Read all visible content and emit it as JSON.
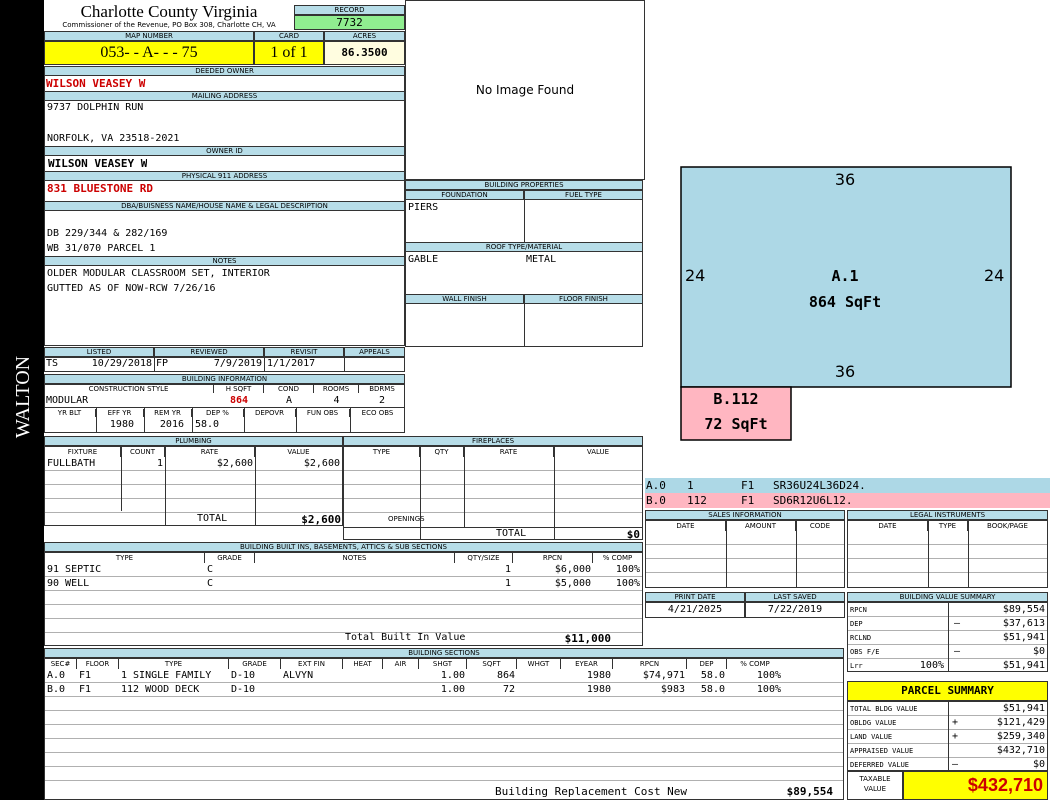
{
  "header": {
    "county": "Charlotte County Virginia",
    "commissioner": "Commissioner of the Revenue, PO Box 308, Charlotte CH, VA",
    "record_label": "RECORD",
    "record": "7732",
    "map_label": "MAP NUMBER",
    "map_number": "053- - A- - - 75",
    "card_label": "CARD",
    "card": "1 of 1",
    "acres_label": "ACRES",
    "acres": "86.3500",
    "side_label": "WALTON"
  },
  "owner": {
    "deeded_label": "DEEDED OWNER",
    "deeded": "WILSON VEASEY W",
    "mailing_label": "MAILING ADDRESS",
    "mail1": "9737 DOLPHIN RUN",
    "mail2": "NORFOLK, VA 23518-2021",
    "id_label": "OWNER ID",
    "id": "WILSON VEASEY W",
    "addr_label": "PHYSICAL 911 ADDRESS",
    "addr": "831 BLUESTONE RD",
    "legal_label": "DBA/BUISNESS NAME/HOUSE NAME & LEGAL DESCRIPTION",
    "legal1": "DB 229/344 & 282/169",
    "legal2": "WB 31/070 PARCEL 1",
    "notes_label": "NOTES",
    "notes1": "OLDER MODULAR CLASSROOM SET, INTERIOR",
    "notes2": "GUTTED AS OF NOW-RCW 7/26/16"
  },
  "image": {
    "text": "No Image Found"
  },
  "props": {
    "title": "BUILDING PROPERTIES",
    "foundation_label": "FOUNDATION",
    "fuel_label": "FUEL TYPE",
    "foundation": "PIERS",
    "roof_label": "ROOF TYPE/MATERIAL",
    "roof_type": "GABLE",
    "roof_mat": "METAL",
    "wall_label": "WALL FINISH",
    "floor_label": "FLOOR FINISH"
  },
  "dates": {
    "listed_label": "LISTED",
    "listed_code": "TS",
    "listed": "10/29/2018",
    "reviewed_label": "REVIEWED",
    "reviewed_code": "FP",
    "reviewed": "7/9/2019",
    "revisit_label": "REVISIT",
    "revisit": "1/1/2017",
    "appeals_label": "APPEALS"
  },
  "bldg": {
    "title": "BUILDING INFORMATION",
    "cs_label": "CONSTRUCTION STYLE",
    "hsqft_label": "H SQFT",
    "cond_label": "COND",
    "rooms_label": "ROOMS",
    "bdrms_label": "BDRMS",
    "style": "MODULAR",
    "hsqft": "864",
    "cond": "A",
    "rooms": "4",
    "bdrms": "2",
    "yrblt_label": "YR BLT",
    "effyr_label": "EFF YR",
    "remyr_label": "REM YR",
    "dep_label": "DEP %",
    "depovr_label": "DEPOVR",
    "funobs_label": "FUN OBS",
    "ecoobs_label": "ECO OBS",
    "yrblt": "1980",
    "remyr": "2016",
    "dep": "58.0"
  },
  "plumbing": {
    "title": "PLUMBING",
    "cols": [
      "FIXTURE",
      "COUNT",
      "RATE",
      "VALUE"
    ],
    "rows": [
      [
        "FULLBATH",
        "1",
        "$2,600",
        "$2,600"
      ]
    ],
    "total_label": "TOTAL",
    "total": "$2,600"
  },
  "fireplaces": {
    "title": "FIREPLACES",
    "cols": [
      "TYPE",
      "QTY",
      "RATE",
      "VALUE"
    ],
    "openings_label": "OPENINGS",
    "total_label": "TOTAL",
    "total": "$0"
  },
  "builtins": {
    "title": "BUILDING BUILT INS, BASEMENTS, ATTICS & SUB SECTIONS",
    "cols": [
      "TYPE",
      "GRADE",
      "NOTES",
      "QTY/SIZE",
      "RPCN",
      "% COMP"
    ],
    "rows": [
      [
        "91 SEPTIC",
        "C",
        "",
        "1",
        "$6,000",
        "100%"
      ],
      [
        "90 WELL",
        "C",
        "",
        "1",
        "$5,000",
        "100%"
      ]
    ],
    "total_label": "Total Built In Value",
    "total": "$11,000"
  },
  "sections": {
    "title": "BUILDING SECTIONS",
    "cols": [
      "SEC#",
      "FLOOR",
      "TYPE",
      "GRADE",
      "EXT FIN",
      "HEAT",
      "AIR",
      "SHGT",
      "SQFT",
      "WHGT",
      "EYEAR",
      "RPCN",
      "DEP",
      "% COMP"
    ],
    "rows": [
      [
        "A.0",
        "F1",
        "1 SINGLE FAMILY",
        "D-10",
        "ALVYN",
        "",
        "",
        "1.00",
        "864",
        "",
        "1980",
        "$74,971",
        "58.0",
        "100%"
      ],
      [
        "B.0",
        "F1",
        "112 WOOD DECK",
        "D-10",
        "",
        "",
        "",
        "1.00",
        "72",
        "",
        "1980",
        "$983",
        "58.0",
        "100%"
      ]
    ],
    "brcn_label": "Building Replacement Cost New",
    "brcn": "$89,554"
  },
  "sketch": {
    "a_label": "A.1",
    "a_area": "864 SqFt",
    "b_label": "B.112",
    "b_area": "72 SqFt",
    "top": "36",
    "bottom": "36",
    "left": "24",
    "right": "24",
    "colors": {
      "a": "#add8e6",
      "b": "#ffb6c1"
    },
    "codes": [
      [
        "A.0",
        "1",
        "F1",
        "SR36U24L36D24."
      ],
      [
        "B.0",
        "112",
        "F1",
        "SD6R12U6L12."
      ]
    ]
  },
  "sales": {
    "title": "SALES INFORMATION",
    "cols": [
      "DATE",
      "AMOUNT",
      "CODE"
    ]
  },
  "legal_inst": {
    "title": "LEGAL INSTRUMENTS",
    "cols": [
      "DATE",
      "TYPE",
      "BOOK/PAGE"
    ]
  },
  "print": {
    "print_label": "PRINT DATE",
    "print": "4/21/2025",
    "saved_label": "LAST SAVED",
    "saved": "7/22/2019"
  },
  "value_summary": {
    "title": "BUILDING VALUE SUMMARY",
    "rows": [
      [
        "RPCN",
        "",
        "",
        "$89,554"
      ],
      [
        "DEP",
        "",
        "–",
        "$37,613"
      ],
      [
        "RCLND",
        "",
        "",
        "$51,941"
      ],
      [
        "OBS F/E",
        "",
        "–",
        "$0"
      ],
      [
        "Lrr",
        "100%",
        "",
        "$51,941"
      ]
    ]
  },
  "parcel": {
    "title": "PARCEL SUMMARY",
    "rows": [
      [
        "TOTAL BLDG VALUE",
        "",
        "$51,941"
      ],
      [
        "OBLDG VALUE",
        "+",
        "$121,429"
      ],
      [
        "LAND VALUE",
        "+",
        "$259,340"
      ],
      [
        "APPRAISED VALUE",
        "",
        "$432,710"
      ],
      [
        "DEFERRED VALUE",
        "–",
        "$0"
      ]
    ],
    "taxable_label1": "TAXABLE",
    "taxable_label2": "VALUE",
    "taxable": "$432,710"
  }
}
